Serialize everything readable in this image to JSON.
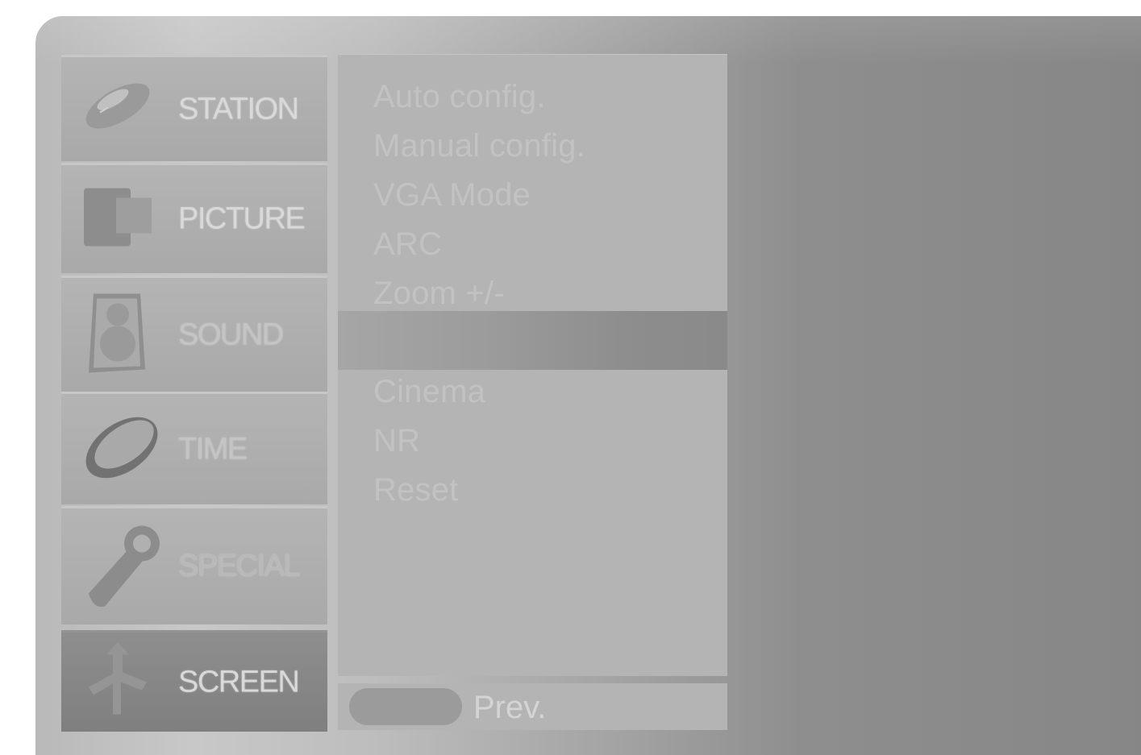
{
  "menu": {
    "tabs": [
      {
        "id": "station",
        "label": "STATION",
        "icon": "satellite-dish-icon",
        "active": false
      },
      {
        "id": "picture",
        "label": "PICTURE",
        "icon": "screen-square-icon",
        "active": false
      },
      {
        "id": "sound",
        "label": "SOUND",
        "icon": "speaker-icon",
        "active": false
      },
      {
        "id": "time",
        "label": "TIME",
        "icon": "clock-oval-icon",
        "active": false
      },
      {
        "id": "special",
        "label": "SPECIAL",
        "icon": "wrench-icon",
        "active": false
      },
      {
        "id": "screen",
        "label": "SCREEN",
        "icon": "move-arrows-icon",
        "active": true
      }
    ]
  },
  "submenu": {
    "items_top": [
      "Auto config.",
      "Manual config.",
      "VGA Mode",
      "ARC",
      "Zoom +/-"
    ],
    "items_bottom": [
      "Cinema",
      "NR",
      "Reset"
    ],
    "footer": {
      "prev_label": "Prev."
    }
  }
}
